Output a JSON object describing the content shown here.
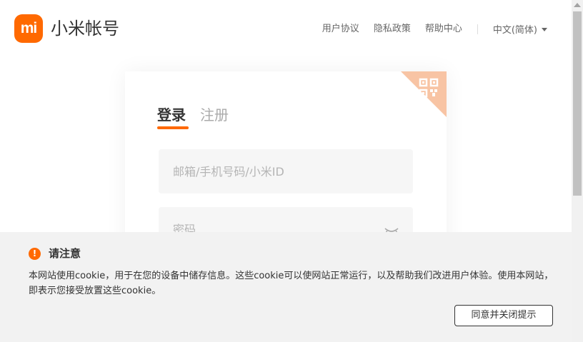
{
  "header": {
    "logo_text": "mi",
    "brand": "小米帐号",
    "nav": {
      "user_agreement": "用户协议",
      "privacy_policy": "隐私政策",
      "help_center": "帮助中心",
      "language": "中文(简体)"
    }
  },
  "login": {
    "tabs": [
      {
        "label": "登录",
        "active": true
      },
      {
        "label": "注册",
        "active": false
      }
    ],
    "account_field": {
      "placeholder": "邮箱/手机号码/小米ID",
      "value": ""
    },
    "password_field": {
      "placeholder": "密码",
      "value": ""
    }
  },
  "cookie_notice": {
    "title": "请注意",
    "icon": "!",
    "text": "本网站使用cookie，用于在您的设备中储存信息。这些cookie可以使网站正常运行，以及帮助我们改进用户体验。使用本网站，即表示您接受放置这些cookie。",
    "button_label": "同意并关闭提示"
  },
  "colors": {
    "brand_orange": "#ff6900",
    "qr_corner": "#f8c4a4",
    "cookie_bg": "#f2f2f2",
    "field_bg": "#f6f6f6"
  }
}
